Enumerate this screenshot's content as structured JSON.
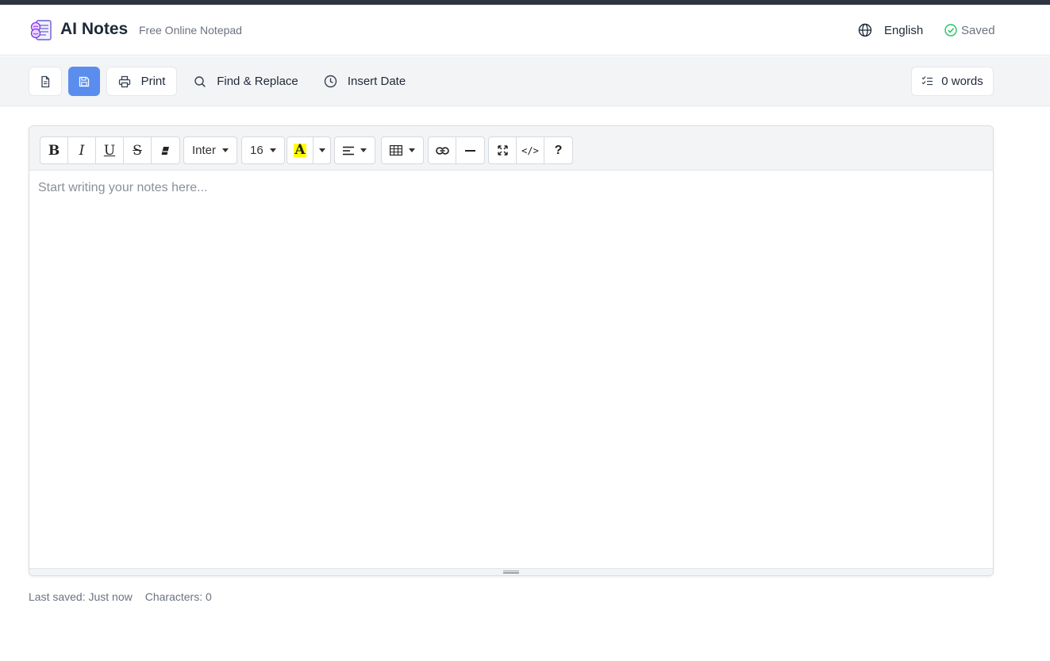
{
  "app": {
    "title": "AI Notes",
    "subtitle": "Free Online Notepad"
  },
  "header": {
    "language": "English",
    "status": "Saved",
    "status_color": "#22c55e"
  },
  "toolbar": {
    "new_icon": "document-icon",
    "save_icon": "save-icon",
    "print_label": "Print",
    "find_label": "Find & Replace",
    "date_label": "Insert Date",
    "word_count": "0 words",
    "accent": "#5b8def"
  },
  "editor": {
    "font": "Inter",
    "size": "16",
    "placeholder": "Start writing your notes here...",
    "highlight_color": "#ffff00",
    "help": "?"
  },
  "footer": {
    "last_saved": "Last saved: Just now",
    "characters": "Characters: 0"
  }
}
